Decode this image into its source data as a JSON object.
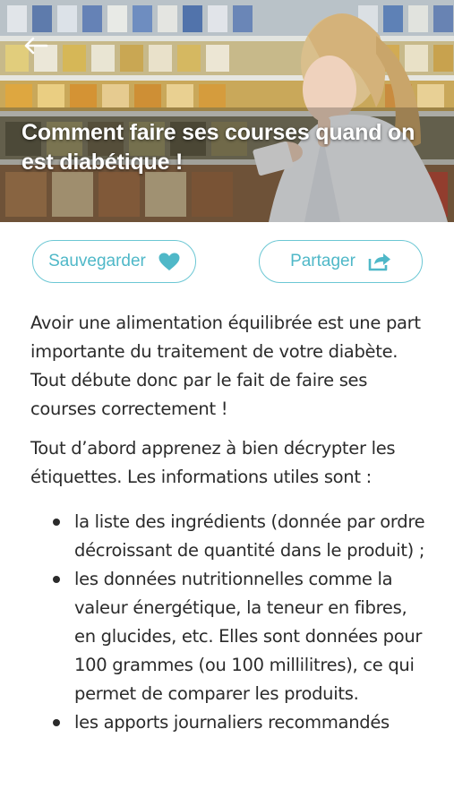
{
  "header": {
    "back_icon": "arrow-left-icon",
    "title": "Comment faire ses courses quand on est diabétique !"
  },
  "actions": {
    "save_label": "Sauvegarder",
    "save_icon": "heart-icon",
    "share_label": "Partager",
    "share_icon": "share-arrow-icon",
    "accent_color": "#4fb8c8"
  },
  "article": {
    "paragraphs": [
      "Avoir une alimentation équilibrée est une part importante du traitement de votre diabète. Tout débute donc par le fait de faire ses courses correctement !",
      "Tout d’abord apprenez à bien décrypter les étiquettes. Les informations utiles sont :"
    ],
    "list": [
      "la liste des ingrédients (donnée par ordre décroissant de quantité dans le produit) ;",
      "les données nutritionnelles comme la valeur énergétique, la teneur en fibres, en glucides, etc. Elles sont données pour 100 grammes (ou 100 millilitres), ce qui permet de comparer les produits.",
      "les apports journaliers recommandés"
    ]
  }
}
